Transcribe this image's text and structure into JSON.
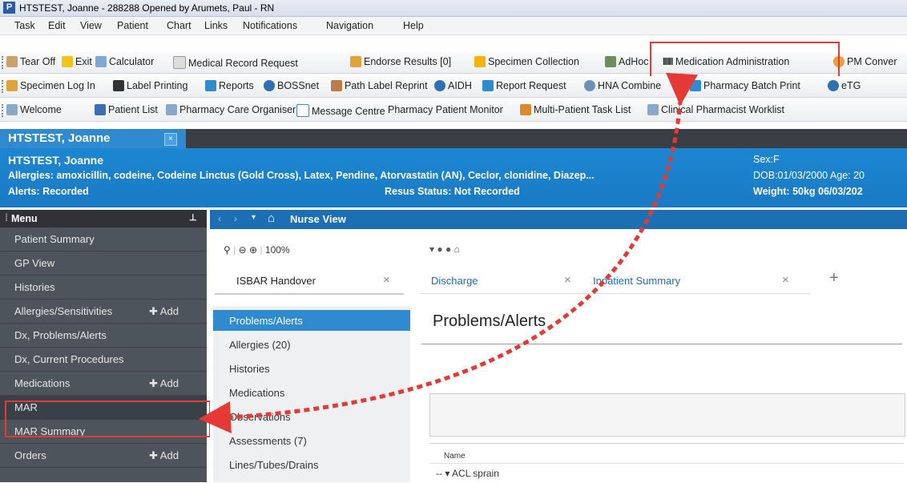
{
  "window": {
    "title": "HTSTEST, Joanne   - 288288 Opened by Arumets, Paul  - RN"
  },
  "menubar": [
    "Task",
    "Edit",
    "View",
    "Patient",
    "Chart",
    "Links",
    "Notifications",
    "Navigation",
    "Help"
  ],
  "toolbar1": [
    "Tear Off",
    "Exit",
    "Calculator",
    "Medical Record Request",
    "Endorse Results [0]",
    "Specimen Collection",
    "AdHoc",
    "Medication Administration",
    "PM Conver"
  ],
  "toolbar2": [
    "Specimen Log In",
    "Label Printing",
    "Reports",
    "BOSSnet",
    "Path Label Reprint",
    "AIDH",
    "Report Request",
    "HNA Combine",
    "Pharmacy Batch Print",
    "eTG"
  ],
  "toolbar3": [
    "Welcome",
    "Patient List",
    "Pharmacy Care Organiser",
    "Message Centre",
    "Pharmacy Patient Monitor",
    "Multi-Patient Task List",
    "Clinical Pharmacist Worklist"
  ],
  "patient_tab": {
    "name": "HTSTEST, Joanne",
    "close": "×"
  },
  "banner": {
    "name": "HTSTEST, Joanne",
    "allergies": "Allergies: amoxicillin, codeine, Codeine Linctus (Gold Cross), Latex, Pendine, Atorvastatin (AN), Ceclor, clonidine, Diazep...",
    "alerts": "Alerts: Recorded",
    "resus": "Resus Status: Not Recorded",
    "sex": "Sex:F",
    "dob": "DOB:01/03/2000   Age: 20",
    "weight": "Weight: 50kg  06/03/202"
  },
  "left_menu": {
    "header": "Menu",
    "items": [
      {
        "label": "Patient Summary",
        "add": ""
      },
      {
        "label": "GP View",
        "add": ""
      },
      {
        "label": "Histories",
        "add": ""
      },
      {
        "label": "Allergies/Sensitivities",
        "add": "Add"
      },
      {
        "label": "Dx, Problems/Alerts",
        "add": ""
      },
      {
        "label": "Dx, Current Procedures",
        "add": ""
      },
      {
        "label": "Medications",
        "add": "Add"
      },
      {
        "label": "MAR",
        "add": ""
      },
      {
        "label": "MAR Summary",
        "add": ""
      },
      {
        "label": "Orders",
        "add": "Add"
      }
    ]
  },
  "content": {
    "view_title": "Nurse View",
    "zoom": "100%",
    "tabs": [
      "ISBAR Handover",
      "Discharge",
      "Inpatient Summary"
    ],
    "nav_items": [
      "Problems/Alerts",
      "Allergies (20)",
      "Histories",
      "Medications",
      "Observations",
      "Assessments (7)",
      "Lines/Tubes/Drains"
    ],
    "section_title": "Problems/Alerts",
    "table_header": "Name",
    "table_rows": [
      "ACL sprain"
    ]
  },
  "colors": {
    "accent": "#1c86d3",
    "highlight": "#e53935",
    "menu_bg": "#4d545b"
  }
}
